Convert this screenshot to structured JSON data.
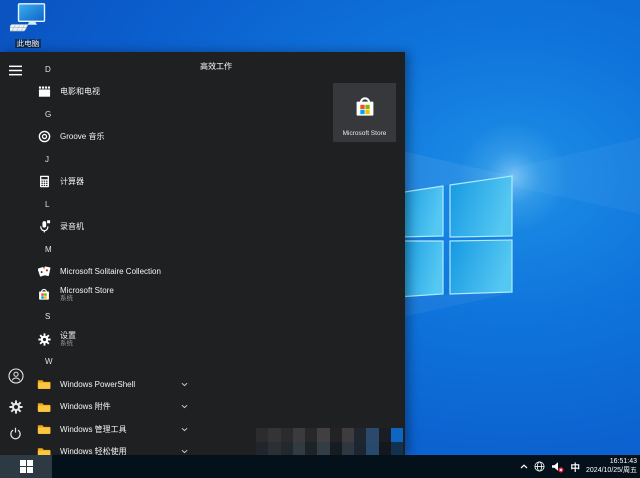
{
  "desktop": {
    "this_pc": {
      "label": "此电脑",
      "icon": "computer-icon"
    }
  },
  "start_menu": {
    "nav_rail": [
      {
        "name": "menu",
        "icon": "hamburger-icon"
      },
      {
        "name": "user",
        "icon": "user-icon"
      },
      {
        "name": "settings",
        "icon": "gear-icon"
      },
      {
        "name": "power",
        "icon": "power-icon"
      }
    ],
    "app_list": [
      {
        "type": "header",
        "label": "D"
      },
      {
        "type": "app",
        "label": "电影和电视",
        "icon": "movies-tv-icon"
      },
      {
        "type": "header",
        "label": "G"
      },
      {
        "type": "app",
        "label": "Groove 音乐",
        "icon": "groove-music-icon"
      },
      {
        "type": "header",
        "label": "J"
      },
      {
        "type": "app",
        "label": "计算器",
        "icon": "calculator-icon"
      },
      {
        "type": "header",
        "label": "L"
      },
      {
        "type": "app",
        "label": "录音机",
        "icon": "voice-recorder-icon"
      },
      {
        "type": "header",
        "label": "M"
      },
      {
        "type": "app",
        "label": "Microsoft Solitaire Collection",
        "icon": "solitaire-icon"
      },
      {
        "type": "app",
        "label": "Microsoft Store",
        "sublabel": "系统",
        "icon": "store-icon"
      },
      {
        "type": "header",
        "label": "S"
      },
      {
        "type": "app",
        "label": "设置",
        "sublabel": "系统",
        "icon": "settings-gear-icon"
      },
      {
        "type": "header",
        "label": "W"
      },
      {
        "type": "folder",
        "label": "Windows PowerShell",
        "icon": "folder-icon"
      },
      {
        "type": "folder",
        "label": "Windows 附件",
        "icon": "folder-icon"
      },
      {
        "type": "folder",
        "label": "Windows 管理工具",
        "icon": "folder-icon"
      },
      {
        "type": "folder",
        "label": "Windows 轻松使用",
        "icon": "folder-icon"
      }
    ],
    "tile_group": {
      "label": "高效工作",
      "tiles": [
        {
          "label": "Microsoft Store",
          "icon": "store-icon"
        }
      ]
    }
  },
  "watermark_mosaic": {
    "rows": [
      [
        "#2c2c2e",
        "#343336",
        "#2b2b2d",
        "#3b3a3d",
        "#28282a",
        "#413f41",
        "#232326",
        "#3e3c3f",
        "#20262f",
        "#2b4a6b",
        "#1a1d23",
        "#0f65c2"
      ],
      [
        "#20262b",
        "#2b3036",
        "#23282c",
        "#333b42",
        "#1d2327",
        "#333d45",
        "#171c20",
        "#2e3740",
        "#1c2630",
        "#27496e",
        "#14181d",
        "#123050"
      ]
    ]
  },
  "taskbar": {
    "start_button": {
      "icon": "windows-flag-icon"
    },
    "tray": {
      "icons": [
        {
          "name": "hidden-icons",
          "icon": "chevron-up-icon"
        },
        {
          "name": "network",
          "icon": "globe-icon"
        },
        {
          "name": "volume-muted",
          "icon": "volume-mute-icon"
        }
      ],
      "ime": "中",
      "time": "16:51:43",
      "date": "2024/10/25/周五"
    }
  },
  "colors": {
    "menu_bg": "#1f2021",
    "tile_bg": "#37383b",
    "taskbar_bg": "#04111b",
    "start_button_bg": "#2e3a43",
    "desktop_blue": "#0f74dc",
    "folder_front": "#fbc540",
    "folder_back": "#eca915",
    "ms_red": "#f25022",
    "ms_green": "#7fba00",
    "ms_blue": "#00a4ef",
    "ms_yellow": "#ffb900",
    "mute_badge": "#e81123"
  }
}
